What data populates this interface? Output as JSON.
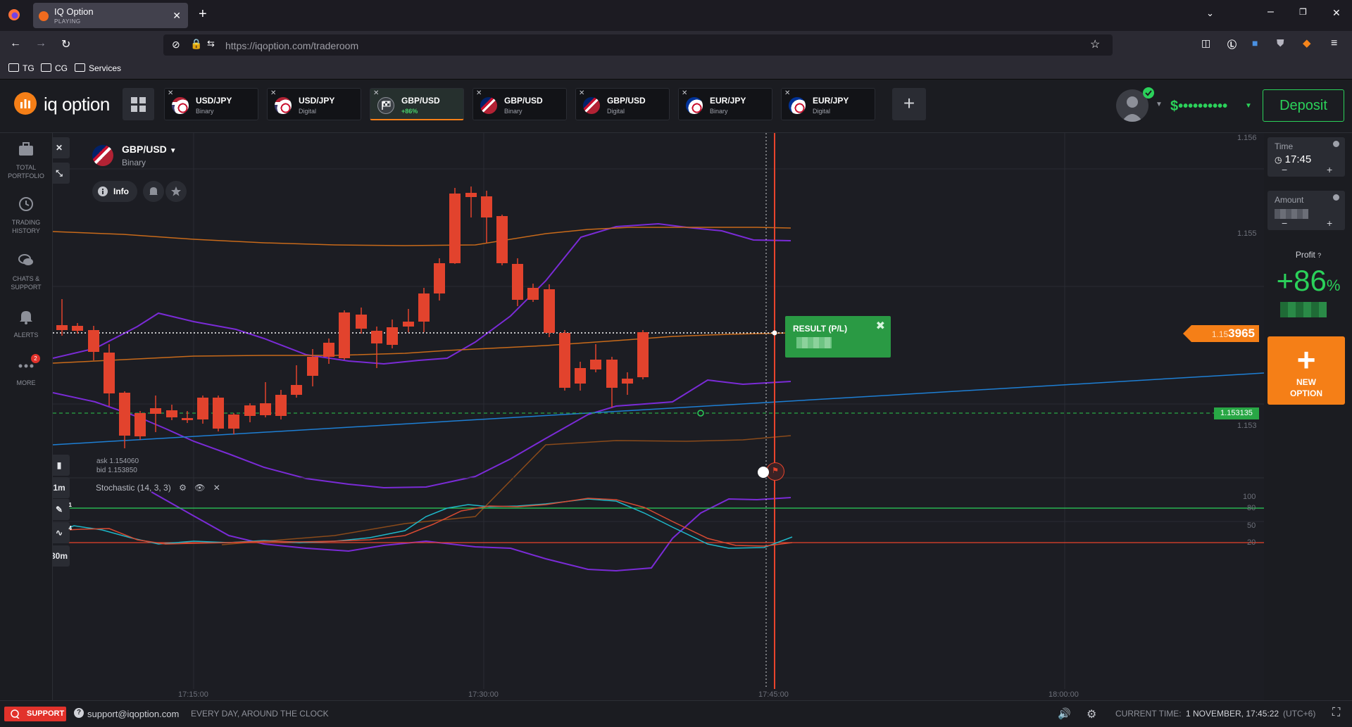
{
  "browser": {
    "tab_title": "IQ Option",
    "tab_status": "PLAYING",
    "url_host": "https://iqoption.com",
    "url_path": "/traderoom",
    "bookmarks": [
      "TG",
      "CG",
      "Services"
    ]
  },
  "header": {
    "logo_text": "iq option",
    "asset_tabs": [
      {
        "name": "USD/JPY",
        "sub": "Binary",
        "active": false
      },
      {
        "name": "USD/JPY",
        "sub": "Digital",
        "active": false
      },
      {
        "name": "GBP/USD",
        "sub": "+86%",
        "active": true
      },
      {
        "name": "GBP/USD",
        "sub": "Binary",
        "active": false
      },
      {
        "name": "GBP/USD",
        "sub": "Digital",
        "active": false
      },
      {
        "name": "EUR/JPY",
        "sub": "Binary",
        "active": false
      },
      {
        "name": "EUR/JPY",
        "sub": "Digital",
        "active": false
      }
    ],
    "add_tab_label": "+",
    "balance": "$••••••••••",
    "deposit_label": "Deposit",
    "colors": {
      "accent": "#f57f17",
      "green": "#2bd15a",
      "red": "#e2322b"
    }
  },
  "sidebar": {
    "items": [
      {
        "label1": "TOTAL",
        "label2": "PORTFOLIO",
        "icon": "briefcase-icon"
      },
      {
        "label1": "TRADING",
        "label2": "HISTORY",
        "icon": "history-icon"
      },
      {
        "label1": "CHATS &",
        "label2": "SUPPORT",
        "icon": "chat-icon"
      },
      {
        "label1": "ALERTS",
        "label2": "",
        "icon": "bell-icon"
      },
      {
        "label1": "MORE",
        "label2": "",
        "icon": "more-icon",
        "badge": "2"
      }
    ]
  },
  "chart": {
    "asset_name": "GBP/USD",
    "asset_type": "Binary",
    "info_label": "Info",
    "price_axis": [
      "1.156",
      "1.155",
      "1.153"
    ],
    "current_price_prefix": "1.15",
    "current_price_main": "3965",
    "level_price": "1.153135",
    "result_label": "RESULT (P/L)",
    "ask": "ask 1.154060",
    "bid": "bid 1.153850",
    "timeframe": "1m",
    "candle_interval": "30m",
    "tool_badges": {
      "draw": "1",
      "indicators": "4"
    },
    "indicator_name": "Stochastic (14, 3, 3)",
    "stoch_axis": [
      "100",
      "80",
      "50",
      "20"
    ],
    "time_axis": [
      "17:15:00",
      "17:30:00",
      "17:45:00",
      "18:00:00"
    ]
  },
  "right_panel": {
    "time_label": "Time",
    "time_value": "17:45",
    "amount_label": "Amount",
    "profit_label": "Profit",
    "profit_value": "+86",
    "profit_unit": "%",
    "new_option_line1": "NEW",
    "new_option_line2": "OPTION"
  },
  "footer": {
    "support_label": "SUPPORT",
    "email": "support@iqoption.com",
    "hours": "EVERY DAY, AROUND THE CLOCK",
    "current_time_label": "CURRENT TIME:",
    "current_time_value": "1 NOVEMBER, 17:45:22",
    "timezone": "(UTC+6)"
  }
}
